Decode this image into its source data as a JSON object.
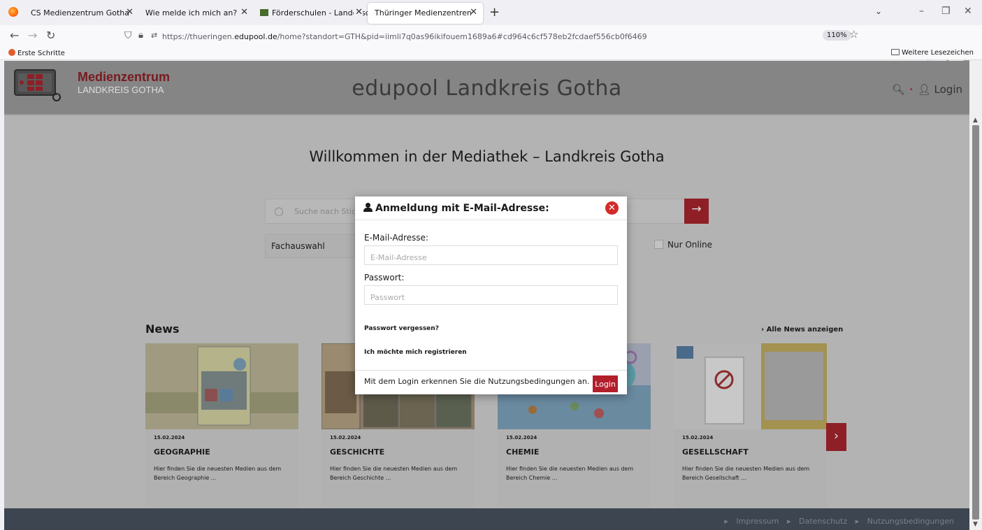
{
  "browser": {
    "tabs": [
      {
        "title": "CS Medienzentrum Gotha"
      },
      {
        "title": "Wie melde ich mich an?"
      },
      {
        "title": "Förderschulen - Landesschüler"
      },
      {
        "title": "Thüringer Medienzentren"
      }
    ],
    "url_prefix": "https://thueringen.",
    "url_host": "edupool.de",
    "url_path": "/home?standort=GTH&pid=iimli7q0as96ikifouem1689a6#cd964c6cf578eb2fcdaef556cb0f6469",
    "zoom": "110%",
    "bookmarks": {
      "first": "Erste Schritte",
      "more": "Weitere Lesezeichen"
    }
  },
  "header": {
    "logo_title": "Medienzentrum",
    "logo_subtitle": "LANDKREIS GOTHA",
    "site_title": "edupool Landkreis Gotha",
    "login_label": "Login"
  },
  "main": {
    "welcome": "Willkommen in der Mediathek – Landkreis Gotha",
    "search_placeholder": "Suche nach Stich",
    "fach_label": "Fachauswahl",
    "online_label": "Nur Online",
    "news_title": "News",
    "news_all": "Alle News anzeigen",
    "cards": [
      {
        "date": "15.02.2024",
        "category": "GEOGRAPHIE",
        "desc": "Hier finden Sie die neuesten Medien aus dem Bereich Geographie ..."
      },
      {
        "date": "15.02.2024",
        "category": "GESCHICHTE",
        "desc": "Hier finden Sie die neuesten Medien aus dem Bereich Geschichte ..."
      },
      {
        "date": "15.02.2024",
        "category": "CHEMIE",
        "desc": "Hier finden Sie die neuesten Medien aus dem Bereich Chemie ..."
      },
      {
        "date": "15.02.2024",
        "category": "GESELLSCHAFT",
        "desc": "Hier finden Sie die neuesten Medien aus dem Bereich Gesellschaft ..."
      }
    ]
  },
  "footer": {
    "links": [
      "Impressum",
      "Datenschutz",
      "Nutzungsbedingungen"
    ]
  },
  "modal": {
    "title": "Anmeldung mit E-Mail-Adresse:",
    "email_label": "E-Mail-Adresse:",
    "email_placeholder": "E-Mail-Adresse",
    "password_label": "Passwort:",
    "password_placeholder": "Passwort",
    "forgot_link": "Passwort vergessen?",
    "register_link": "Ich möchte mich registrieren",
    "terms": "Mit dem Login erkennen Sie die Nutzungsbedingungen an.",
    "login_button": "Login"
  },
  "colors": {
    "brand_red": "#b21f2b",
    "overlay_gray": "#b3b3b3",
    "footer": "#3c4550"
  }
}
